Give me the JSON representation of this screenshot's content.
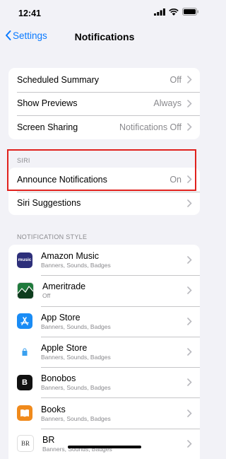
{
  "status_bar": {
    "time": "12:41"
  },
  "nav": {
    "back_label": "Settings",
    "title": "Notifications"
  },
  "general": {
    "rows": [
      {
        "label": "Scheduled Summary",
        "value": "Off"
      },
      {
        "label": "Show Previews",
        "value": "Always"
      },
      {
        "label": "Screen Sharing",
        "value": "Notifications Off"
      }
    ]
  },
  "siri": {
    "header": "SIRI",
    "rows": [
      {
        "label": "Announce Notifications",
        "value": "On"
      },
      {
        "label": "Siri Suggestions",
        "value": ""
      }
    ]
  },
  "notification_style": {
    "header": "NOTIFICATION STYLE",
    "apps": [
      {
        "name": "Amazon Music",
        "subtitle": "Banners, Sounds, Badges",
        "icon": "amazon-music-icon",
        "icon_text": "music",
        "color": "#2d2f7a"
      },
      {
        "name": "Ameritrade",
        "subtitle": "Off",
        "icon": "ameritrade-icon",
        "icon_text": "",
        "color": "#1f7a3c"
      },
      {
        "name": "App Store",
        "subtitle": "Banners, Sounds, Badges",
        "icon": "app-store-icon",
        "icon_text": "",
        "color": "#1a8cf5"
      },
      {
        "name": "Apple Store",
        "subtitle": "Banners, Sounds, Badges",
        "icon": "apple-store-icon",
        "icon_text": "",
        "color": "#ffffff"
      },
      {
        "name": "Bonobos",
        "subtitle": "Banners, Sounds, Badges",
        "icon": "bonobos-icon",
        "icon_text": "B",
        "color": "#111111"
      },
      {
        "name": "Books",
        "subtitle": "Banners, Sounds, Badges",
        "icon": "books-icon",
        "icon_text": "",
        "color": "#f08a1c"
      },
      {
        "name": "BR",
        "subtitle": "Banners, Sounds, Badges",
        "icon": "br-icon",
        "icon_text": "BR",
        "color": "#ffffff"
      }
    ]
  },
  "colors": {
    "accent": "#0a7aff",
    "highlight": "#e0211d",
    "background": "#f2f2f7"
  }
}
